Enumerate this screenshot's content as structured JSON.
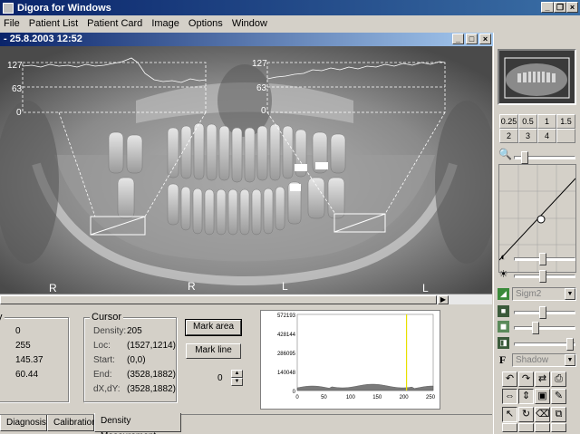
{
  "app": {
    "title": "Digora for Windows"
  },
  "menu": [
    "File",
    "Patient List",
    "Patient Card",
    "Image",
    "Options",
    "Window"
  ],
  "child_window": {
    "title": "- 25.8.2003 12:52"
  },
  "image": {
    "profile_scale": [
      "127",
      "63",
      "0"
    ],
    "markers": {
      "left_r": "R",
      "center_r": "R",
      "center_l": "L",
      "right_l": "L"
    }
  },
  "stats": {
    "values": [
      "0",
      "255",
      "145.37",
      "60.44"
    ]
  },
  "cursor": {
    "legend": "Cursor",
    "rows": [
      {
        "label": "Density:",
        "value": "205"
      },
      {
        "label": "Loc:",
        "value": "(1527,1214)"
      },
      {
        "label": "Start:",
        "value": "(0,0)"
      },
      {
        "label": "End:",
        "value": "(3528,1882)"
      },
      {
        "label": "dX,dY:",
        "value": "(3528,1882)"
      }
    ]
  },
  "buttons": {
    "mark_area": "Mark area",
    "mark_line": "Mark line"
  },
  "spinner": {
    "value": "0"
  },
  "histogram": {
    "y_ticks": [
      "572193",
      "428144",
      "286095",
      "140048",
      "0"
    ],
    "x_ticks": [
      "0",
      "50",
      "100",
      "150",
      "200",
      "250"
    ],
    "cursor_value": 205,
    "x_max": 255
  },
  "tabs": [
    "Diagnosis",
    "Calibration",
    "Density Measurement"
  ],
  "zoom": [
    "0.25",
    "0.5",
    "1",
    "1.5",
    "2",
    "3",
    "4"
  ],
  "filters": {
    "filter1": "Sigm2",
    "filter2": "Shadow"
  },
  "colors": {
    "title_start": "#0a246a",
    "title_end": "#3a6ea5",
    "histogram_cursor": "#e8e000"
  }
}
